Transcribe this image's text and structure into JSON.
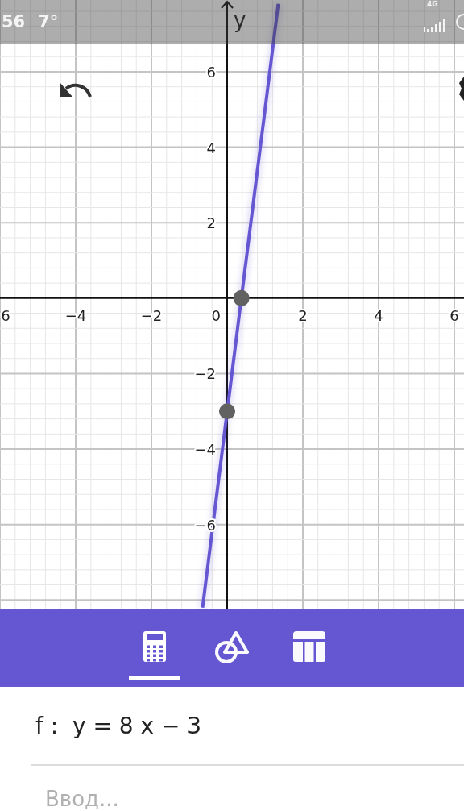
{
  "status_bar": {
    "time": "56",
    "temperature": "7°",
    "network": "4G"
  },
  "graph": {
    "origin_label": "0",
    "intercept_points": {
      "x_axis": true,
      "y_axis": true
    },
    "chart_data": {
      "type": "line",
      "ylabel": "y",
      "grid": true,
      "x": [
        -0.65,
        1.35
      ],
      "series": [
        {
          "color": "#6557d2",
          "values": [
            -8.2,
            7.8
          ]
        }
      ],
      "xlim": [
        -6,
        6.255
      ],
      "ylim": [
        -8.25,
        7.9
      ],
      "xticks": [
        {
          "value": -6,
          "label": "6"
        },
        {
          "value": -4,
          "label": "−4"
        },
        {
          "value": -2,
          "label": "−2"
        },
        {
          "value": 2,
          "label": "2"
        },
        {
          "value": 4,
          "label": "4"
        },
        {
          "value": 6,
          "label": "6"
        }
      ],
      "yticks": [
        {
          "value": 6,
          "label": "6"
        },
        {
          "value": 4,
          "label": "4"
        },
        {
          "value": 2,
          "label": "2"
        },
        {
          "value": -2,
          "label": "−2"
        },
        {
          "value": -4,
          "label": "−4"
        },
        {
          "value": -6,
          "label": "−6"
        }
      ]
    }
  },
  "toolbar": {
    "tabs": [
      {
        "kind": "calculator",
        "selected": true
      },
      {
        "kind": "shapes",
        "selected": false
      },
      {
        "kind": "table",
        "selected": false
      }
    ]
  },
  "algebra": {
    "entries": [
      "f :  y = 8 x − 3"
    ],
    "input": {
      "placeholder": "Ввод..."
    }
  }
}
